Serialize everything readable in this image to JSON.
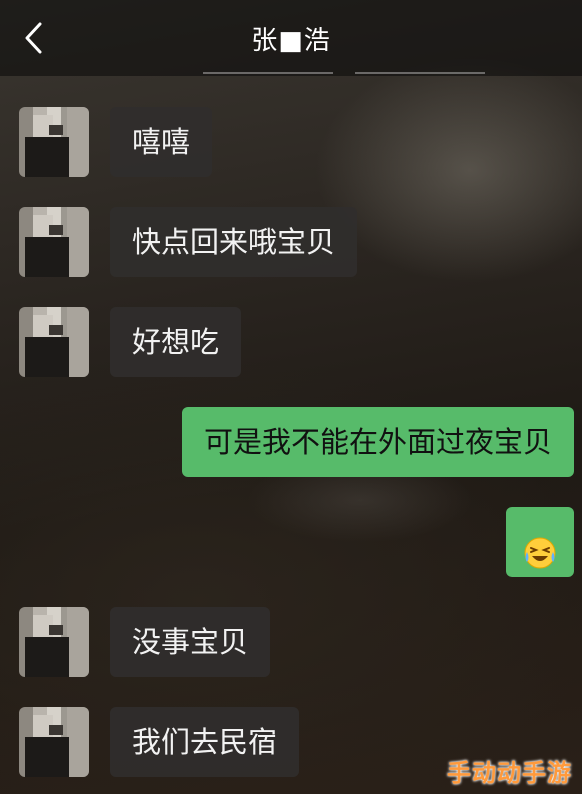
{
  "header": {
    "title": "张■浩"
  },
  "messages": [
    {
      "side": "left",
      "text": "嘻嘻"
    },
    {
      "side": "left",
      "text": "快点回来哦宝贝"
    },
    {
      "side": "left",
      "text": "好想吃"
    },
    {
      "side": "right",
      "text": "可是我不能在外面过夜宝贝"
    },
    {
      "side": "right",
      "emoji": "crying-laughing-emoji"
    },
    {
      "side": "left",
      "text": "没事宝贝"
    },
    {
      "side": "left",
      "text": "我们去民宿"
    }
  ],
  "watermark": "手动动手游",
  "colors": {
    "outgoing_bubble": "#57bb6a",
    "incoming_bubble": "#302e2c",
    "watermark": "#ff9a3c"
  }
}
